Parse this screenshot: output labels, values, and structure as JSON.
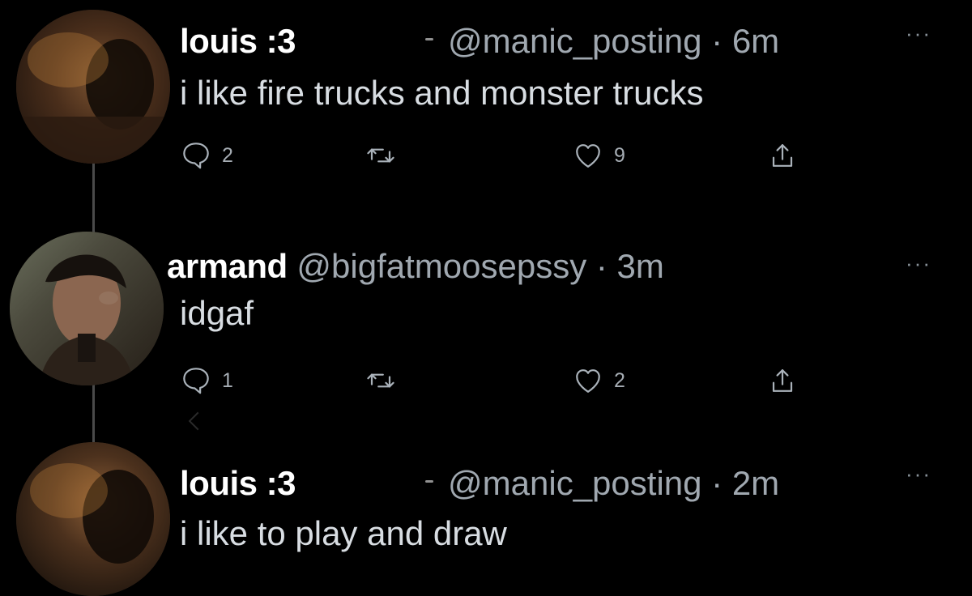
{
  "tweets": [
    {
      "display_name": "louis :3",
      "handle_time": "@manic_posting · 6m",
      "text": "i like fire trucks and monster trucks",
      "more": "···",
      "actions": {
        "reply_count": "2",
        "retweet_count": "",
        "like_count": "9"
      }
    },
    {
      "display_name": "armand",
      "handle_time": "@bigfatmoosepssy · 3m",
      "text": "idgaf",
      "more": "···",
      "actions": {
        "reply_count": "1",
        "retweet_count": "",
        "like_count": "2"
      }
    },
    {
      "display_name": "louis :3",
      "handle_time": "@manic_posting · 2m",
      "text": "i like to play and draw",
      "more": "···"
    }
  ],
  "icons": {
    "reply": "reply-icon",
    "retweet": "retweet-icon",
    "like": "heart-icon",
    "share": "share-icon",
    "more": "more-icon"
  },
  "colors": {
    "background": "#000000",
    "display_name": "#ffffff",
    "secondary_text": "#a0a8b0",
    "body_text": "#d8dde2",
    "icons": "#aab2ba",
    "thread_line": "#4a4a4a"
  }
}
